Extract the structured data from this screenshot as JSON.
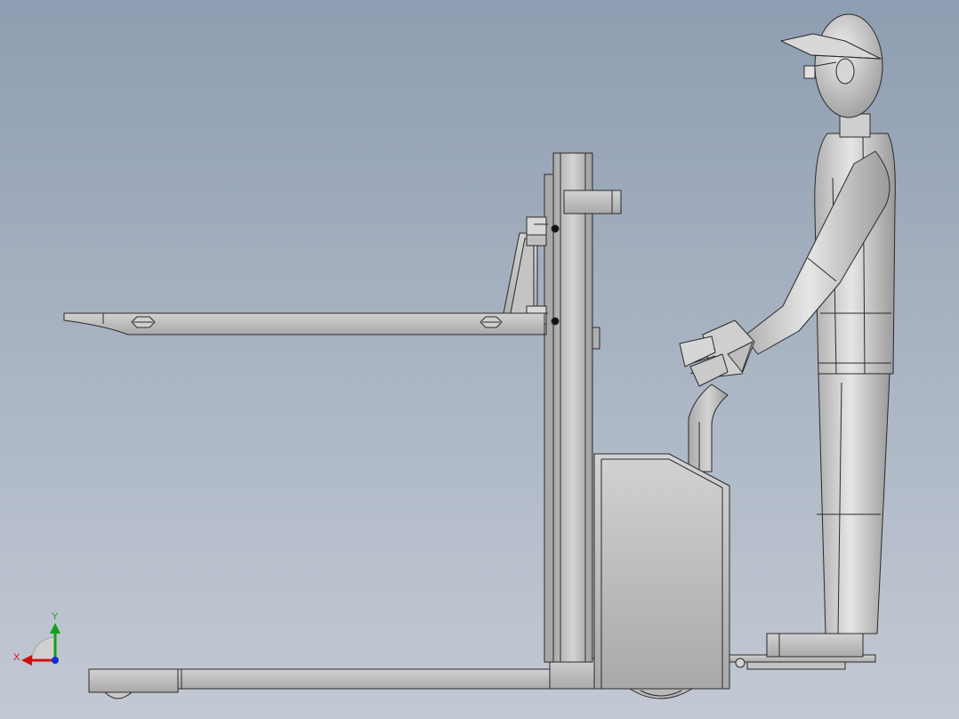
{
  "viewport": {
    "background_top": "#8e9db1",
    "background_bottom": "#c3c9d4"
  },
  "model": {
    "part_color": "#bcbcbc",
    "edge_color": "#2a2a2a",
    "components": [
      "fork",
      "mast",
      "carriage",
      "battery-box",
      "tiller-handle",
      "base-frame",
      "wheels",
      "platform",
      "operator-mannequin"
    ]
  },
  "triad": {
    "x_label": "X",
    "y_label": "Y",
    "x_color": "#d01010",
    "y_color": "#10a020",
    "z_color": "#1030d0"
  }
}
